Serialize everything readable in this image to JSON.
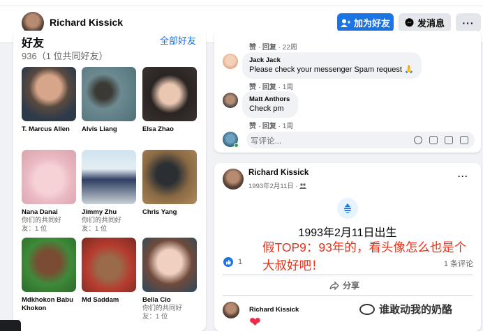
{
  "header": {
    "profile_name": "Richard Kissick",
    "add_friend_label": "加为好友",
    "message_label": "发消息",
    "more_label": "···"
  },
  "friends": {
    "title": "好友",
    "see_all": "全部好友",
    "count_text": "936（1 位共同好友）",
    "items": [
      {
        "name": "T. Marcus Allen",
        "mutual": ""
      },
      {
        "name": "Alvis Liang",
        "mutual": ""
      },
      {
        "name": "Elsa Zhao",
        "mutual": ""
      },
      {
        "name": "Nana Danai",
        "mutual": "你们的共同好友：1 位"
      },
      {
        "name": "Jimmy Zhu",
        "mutual": "你们的共同好友：1 位"
      },
      {
        "name": "Chris Yang",
        "mutual": ""
      },
      {
        "name": "Mdkhokon Babu Khokon",
        "mutual": ""
      },
      {
        "name": "Md Saddam",
        "mutual": ""
      },
      {
        "name": "Bella Cio",
        "mutual": "你们的共同好友：1 位"
      }
    ]
  },
  "comments": {
    "actions_top": {
      "like": "赞",
      "reply": "回复",
      "time": "22周"
    },
    "items": [
      {
        "author": "Jack Jack",
        "text": "Please check your messenger Spam request 🙏",
        "like": "赞",
        "reply": "回复",
        "time": "1周"
      },
      {
        "author": "Matt Anthors",
        "text": "Check pm",
        "like": "赞",
        "reply": "回复",
        "time": "1周"
      }
    ],
    "write_placeholder": "写评论..."
  },
  "post": {
    "author": "Richard Kissick",
    "date": "1993年2月11日 ·",
    "more": "···",
    "event_text": "1993年2月11日出生",
    "reaction_count": "1",
    "comment_count": "1 条评论",
    "share_label": "分享",
    "comment_author": "Richard Kissick",
    "comment_emoji": "❤"
  },
  "annotation": {
    "line1": "假TOP9：93年的，看头像怎么也是个",
    "line2": "大叔好吧！"
  },
  "watermark": {
    "text": "谁敢动我的奶酪"
  },
  "colors": {
    "brand_blue": "#1b74e4",
    "annotation_red": "#e8321a"
  }
}
